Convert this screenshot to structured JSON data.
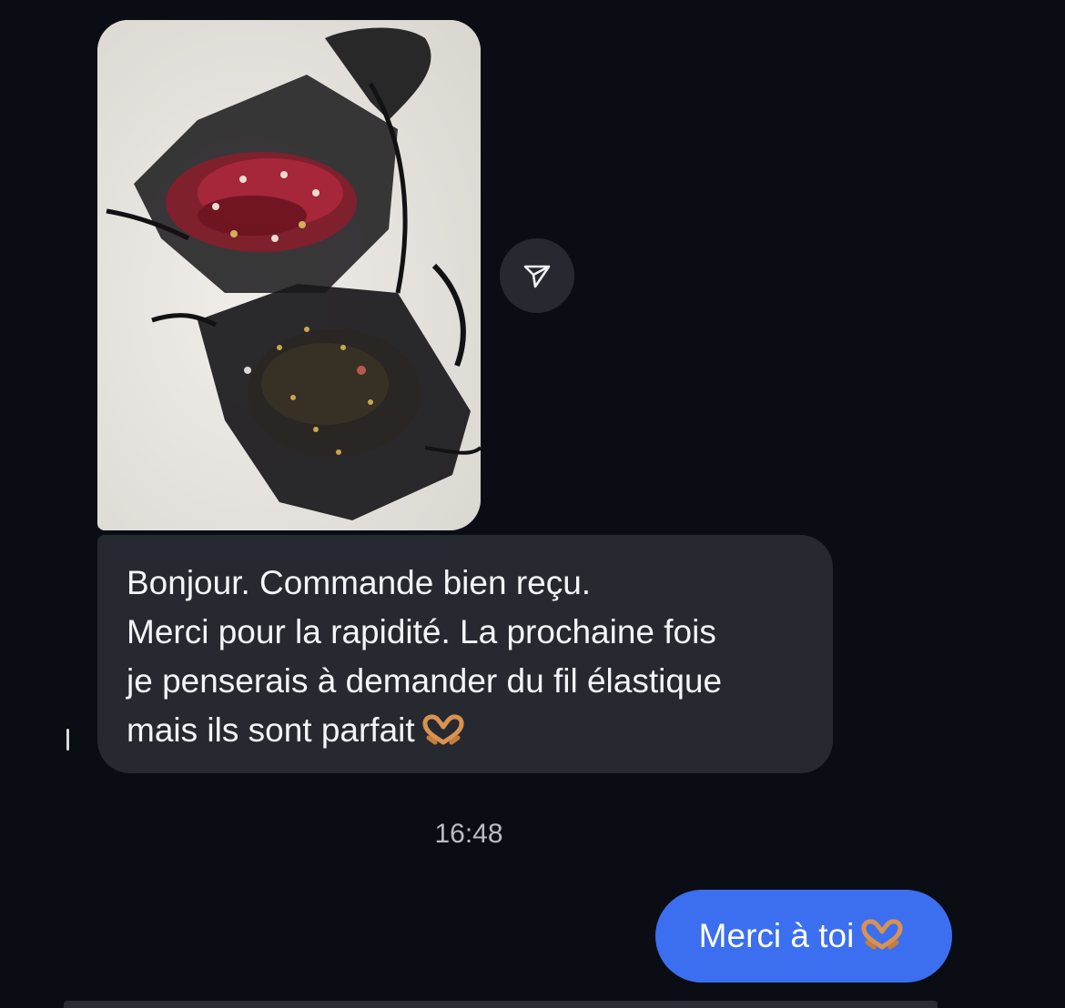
{
  "conversation": {
    "received_image": {
      "icon": "photo-of-bead-pouches"
    },
    "share": {
      "icon": "paper-plane-icon"
    },
    "received_message": {
      "lines": [
        "Bonjour. Commande bien reçu.",
        "Merci pour la rapidité. La prochaine fois",
        "je penserais à demander du fil élastique",
        "mais ils sont parfait"
      ],
      "emoji": "heart-hands-icon"
    },
    "timestamp": "16:48",
    "sent_message": {
      "text": "Merci à toi",
      "emoji": "heart-hands-icon"
    }
  },
  "colors": {
    "background": "#0b0d14",
    "received_bubble": "#262930",
    "sent_bubble": "#3b6ff0",
    "timestamp_text": "#b9bcc4"
  }
}
